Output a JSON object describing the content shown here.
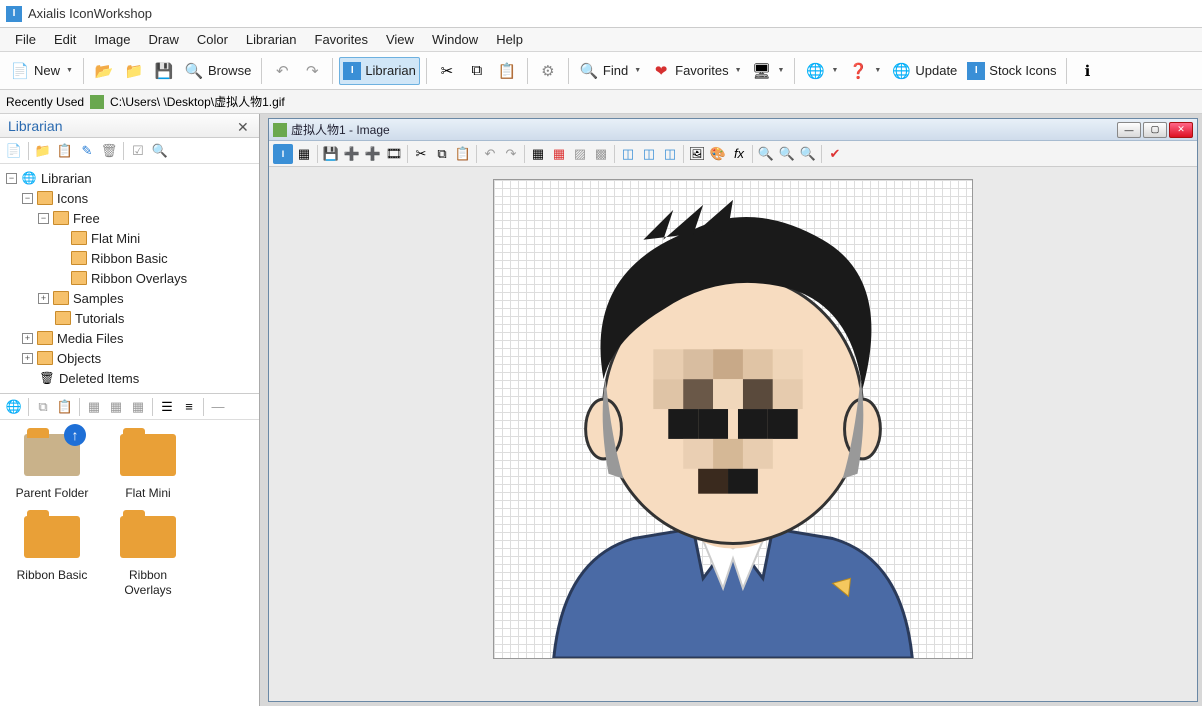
{
  "app": {
    "title": "Axialis IconWorkshop"
  },
  "menu": [
    "File",
    "Edit",
    "Image",
    "Draw",
    "Color",
    "Librarian",
    "Favorites",
    "View",
    "Window",
    "Help"
  ],
  "toolbar": {
    "new": "New",
    "browse": "Browse",
    "librarian": "Librarian",
    "find": "Find",
    "favorites": "Favorites",
    "update": "Update",
    "stock": "Stock Icons"
  },
  "recent": {
    "label": "Recently Used",
    "path": "C:\\Users\\            \\Desktop\\虚拟人物1.gif"
  },
  "librarian": {
    "title": "Librarian",
    "tree": {
      "root": "Librarian",
      "icons": "Icons",
      "free": "Free",
      "flatmini": "Flat Mini",
      "ribbonbasic": "Ribbon Basic",
      "ribbonoverlays": "Ribbon Overlays",
      "samples": "Samples",
      "tutorials": "Tutorials",
      "mediafiles": "Media Files",
      "objects": "Objects",
      "deleted": "Deleted Items"
    },
    "thumbs": {
      "parent": "Parent Folder",
      "flatmini": "Flat Mini",
      "ribbonbasic": "Ribbon Basic",
      "ribbonoverlays": "Ribbon Overlays"
    }
  },
  "doc": {
    "title": "虚拟人物1 - Image"
  }
}
